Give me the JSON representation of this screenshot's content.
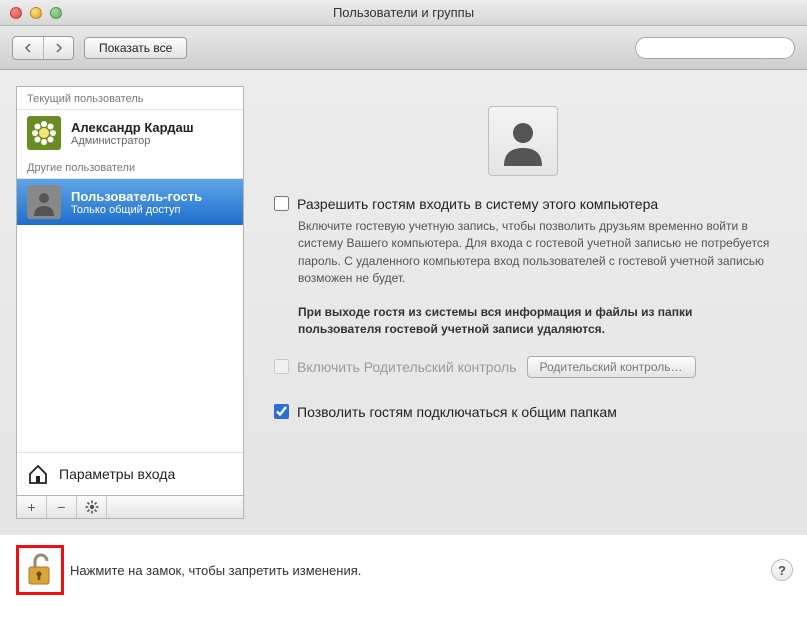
{
  "window": {
    "title": "Пользователи и группы"
  },
  "toolbar": {
    "show_all": "Показать все",
    "search_placeholder": ""
  },
  "sidebar": {
    "current_user_label": "Текущий пользователь",
    "other_users_label": "Другие пользователи",
    "current_user": {
      "name": "Александр Кардаш",
      "role": "Администратор"
    },
    "other_users": [
      {
        "name": "Пользователь-гость",
        "role": "Только общий доступ",
        "selected": true
      }
    ],
    "login_options": "Параметры входа"
  },
  "content": {
    "allow_guests_label": "Разрешить гостям входить в систему этого компьютера",
    "allow_guests_checked": false,
    "guest_note": "Включите гостевую учетную запись, чтобы позволить друзьям временно войти в систему Вашего компьютера. Для входа с гостевой учетной записью не потребуется пароль. С удаленного компьютера вход пользователей с гостевой учетной записью возможен не будет.",
    "guest_logout_note": "При выходе гостя из системы вся информация и файлы из папки пользователя гостевой учетной записи удаляются.",
    "parental_enable_label": "Включить Родительский контроль",
    "parental_enable_checked": false,
    "parental_open_button": "Родительский контроль…",
    "allow_shares_label": "Позволить гостям подключаться к общим папкам",
    "allow_shares_checked": true
  },
  "footer": {
    "lock_text": "Нажмите на замок, чтобы запретить изменения."
  }
}
